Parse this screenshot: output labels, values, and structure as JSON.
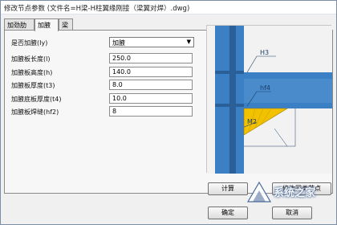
{
  "window": {
    "title": "修改节点参数 (文件名=H梁-H柱翼缘刚接（梁翼对焊）.dwg)"
  },
  "tabs": [
    {
      "label": "加劲肋",
      "active": false
    },
    {
      "label": "加腋",
      "active": true
    },
    {
      "label": "梁",
      "active": false
    }
  ],
  "form": {
    "has_haunch_label": "是否加腋(Iy)",
    "has_haunch_value": "加腋",
    "plate_length_label": "加腋板长度(l)",
    "plate_length_value": "250.0",
    "plate_height_label": "加腋板高度(h)",
    "plate_height_value": "140.0",
    "plate_thickness_label": "加腋板厚度(t3)",
    "plate_thickness_value": "8.0",
    "bottom_plate_thickness_label": "加腋底板厚度(t4)",
    "bottom_plate_thickness_value": "10.0",
    "weld_size_label": "加腋板焊缝(hf2)",
    "weld_size_value": "8"
  },
  "diagram": {
    "label_h3": "H3",
    "label_hf4": "hf4",
    "label_m2": "M2",
    "colors": {
      "column": "#3b7fc4",
      "column_dark": "#2a5f98",
      "plate": "#f2c200",
      "background": "#f2f2f2"
    }
  },
  "buttons": {
    "calculate": "计算",
    "modify_same_type": "修改同类节点",
    "ok": "确定",
    "cancel": "取消"
  },
  "watermark": {
    "text": "系统之家"
  }
}
